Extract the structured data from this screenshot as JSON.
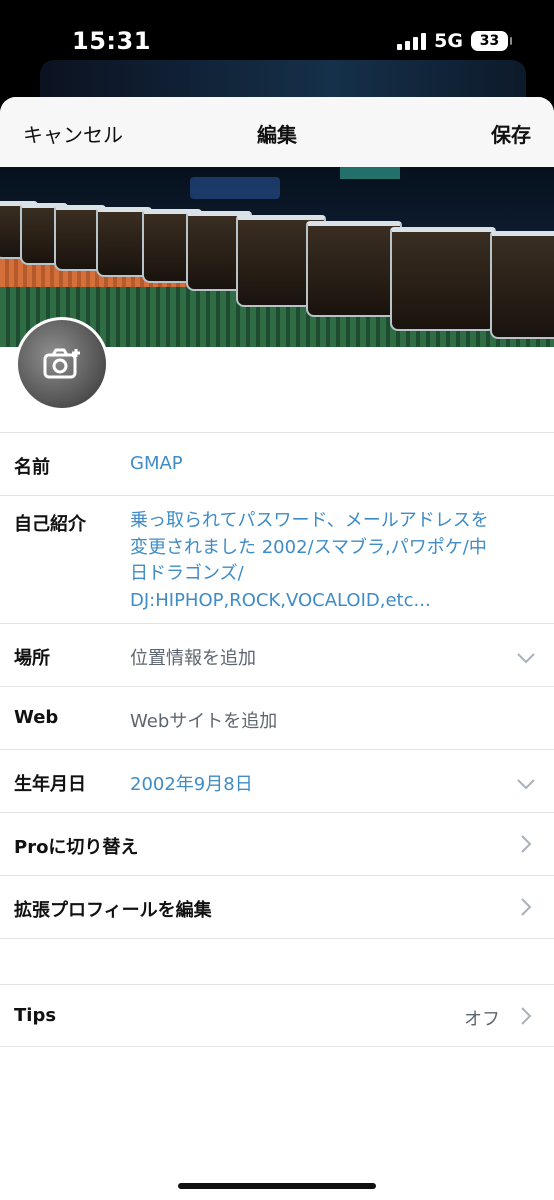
{
  "status": {
    "time": "15:31",
    "network": "5G",
    "battery": "33"
  },
  "nav": {
    "cancel": "キャンセル",
    "title": "編集",
    "save": "保存"
  },
  "fields": {
    "name": {
      "label": "名前",
      "value": "GMAP"
    },
    "bio": {
      "label": "自己紹介",
      "lines": [
        "乗っ取られてパスワード、メールアドレスを",
        "変更されました 2002/スマブラ,パワポケ/中",
        "日ドラゴンズ/",
        "DJ:HIPHOP,ROCK,VOCALOID,etc..."
      ]
    },
    "location": {
      "label": "場所",
      "placeholder": "位置情報を追加"
    },
    "web": {
      "label": "Web",
      "placeholder": "Webサイトを追加"
    },
    "birthday": {
      "label": "生年月日",
      "value": "2002年9月8日"
    },
    "pro": {
      "label": "Proに切り替え"
    },
    "extended": {
      "label": "拡張プロフィールを編集"
    },
    "tips": {
      "label": "Tips",
      "value": "オフ"
    }
  },
  "icons": {
    "avatar_camera": "camera-plus-icon",
    "dropdown": "chevron-down-icon",
    "disclosure": "chevron-right-icon"
  },
  "colors": {
    "accent": "#3f8cc6",
    "text": "#111111",
    "divider": "#e3e3e6"
  }
}
